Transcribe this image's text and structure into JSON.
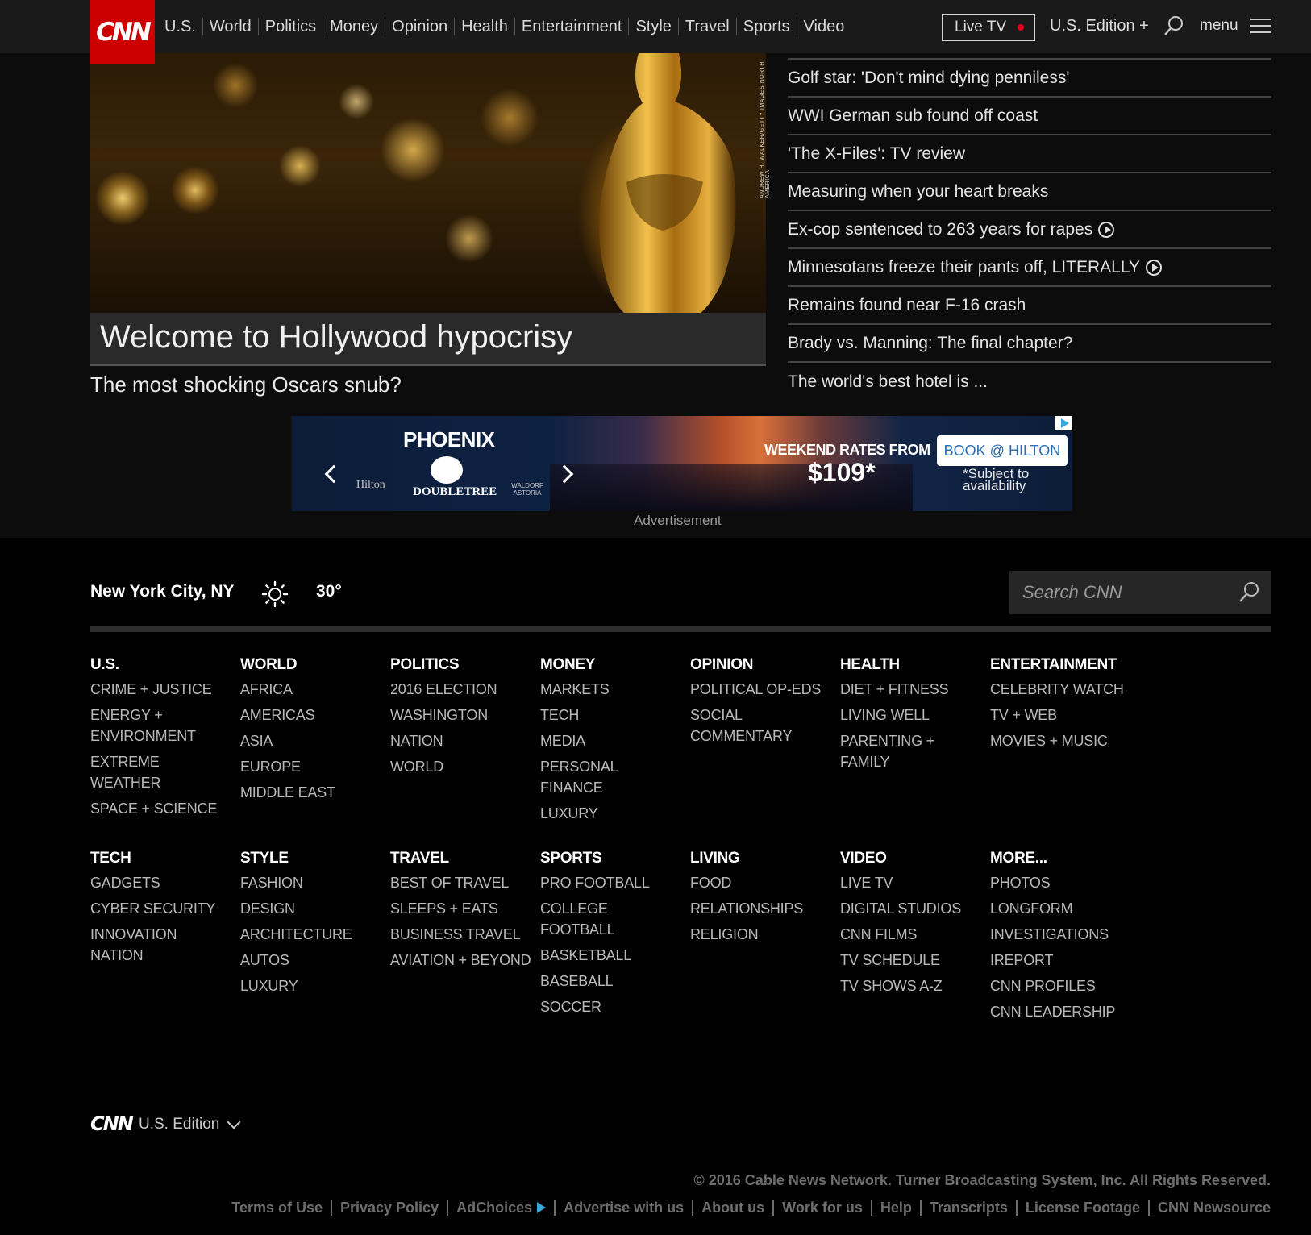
{
  "header": {
    "logo": "CNN",
    "nav": [
      "U.S.",
      "World",
      "Politics",
      "Money",
      "Opinion",
      "Health",
      "Entertainment",
      "Style",
      "Travel",
      "Sports",
      "Video"
    ],
    "live_tv": "Live TV",
    "edition": "U.S. Edition +",
    "menu": "menu"
  },
  "hero": {
    "headline": "Welcome to Hollywood hypocrisy",
    "subheadline": "The most shocking Oscars snub?",
    "photo_credit": "ANDREW H. WALKER/GETTY IMAGES NORTH AMERICA"
  },
  "headlines": [
    {
      "text": "Golf star: 'Don't mind dying penniless'",
      "video": false
    },
    {
      "text": "WWI German sub found off coast",
      "video": false
    },
    {
      "text": "'The X-Files': TV review",
      "video": false
    },
    {
      "text": "Measuring when your heart breaks",
      "video": false
    },
    {
      "text": "Ex-cop sentenced to 263 years for rapes",
      "video": true
    },
    {
      "text": "Minnesotans freeze their pants off, LITERALLY",
      "video": true
    },
    {
      "text": "Remains found near F-16 crash",
      "video": false
    },
    {
      "text": "Brady vs. Manning: The final chapter?",
      "video": false
    },
    {
      "text": "The world's best hotel is ...",
      "video": false
    }
  ],
  "ad": {
    "city": "PHOENIX",
    "brand_hilton": "Hilton",
    "brand_doubletree": "DOUBLETREE",
    "brand_waldorf": "WALDORF ASTORIA",
    "rates_text": "WEEKEND RATES FROM",
    "price": "$109*",
    "cta": "BOOK @ HILTON",
    "disclaimer": "*Subject to availability",
    "label": "Advertisement"
  },
  "weather": {
    "location": "New York City, NY",
    "temperature": "30°",
    "icon": "sun-icon"
  },
  "search": {
    "placeholder": "Search CNN"
  },
  "footer_sections": [
    [
      {
        "title": "U.S.",
        "items": [
          "Crime + Justice",
          "Energy + Environment",
          "Extreme Weather",
          "Space + Science"
        ]
      },
      {
        "title": "World",
        "items": [
          "Africa",
          "Americas",
          "Asia",
          "Europe",
          "Middle East"
        ]
      },
      {
        "title": "Politics",
        "items": [
          "2016 Election",
          "Washington",
          "Nation",
          "World"
        ]
      },
      {
        "title": "Money",
        "items": [
          "Markets",
          "Tech",
          "Media",
          "Personal Finance",
          "Luxury"
        ]
      },
      {
        "title": "Opinion",
        "items": [
          "Political Op-Eds",
          "Social Commentary"
        ]
      },
      {
        "title": "Health",
        "items": [
          "Diet + Fitness",
          "Living Well",
          "Parenting + Family"
        ]
      },
      {
        "title": "Entertainment",
        "items": [
          "Celebrity Watch",
          "TV + Web",
          "Movies + Music"
        ]
      }
    ],
    [
      {
        "title": "Tech",
        "items": [
          "Gadgets",
          "Cyber Security",
          "Innovation Nation"
        ]
      },
      {
        "title": "Style",
        "items": [
          "Fashion",
          "Design",
          "Architecture",
          "Autos",
          "Luxury"
        ]
      },
      {
        "title": "Travel",
        "items": [
          "Best of Travel",
          "Sleeps + Eats",
          "Business Travel",
          "Aviation + Beyond"
        ]
      },
      {
        "title": "Sports",
        "items": [
          "Pro Football",
          "College Football",
          "Basketball",
          "Baseball",
          "Soccer"
        ]
      },
      {
        "title": "Living",
        "items": [
          "Food",
          "Relationships",
          "Religion"
        ]
      },
      {
        "title": "Video",
        "items": [
          "Live TV",
          "Digital Studios",
          "CNN Films",
          "TV Schedule",
          "TV Shows A-Z"
        ]
      },
      {
        "title": "More...",
        "items": [
          "Photos",
          "Longform",
          "Investigations",
          "iReport",
          "CNN Profiles",
          "CNN Leadership"
        ]
      }
    ]
  ],
  "footer": {
    "logo": "CNN",
    "edition": "U.S. Edition",
    "copyright": "© 2016 Cable News Network. Turner Broadcasting System, Inc. All Rights Reserved.",
    "links": [
      "Terms of Use",
      "Privacy Policy",
      "AdChoices",
      "Advertise with us",
      "About us",
      "Work for us",
      "Help",
      "Transcripts",
      "License Footage",
      "CNN Newsource"
    ]
  },
  "colors": {
    "brand_red": "#cc0000",
    "adchoices_blue": "#39a7dc"
  }
}
